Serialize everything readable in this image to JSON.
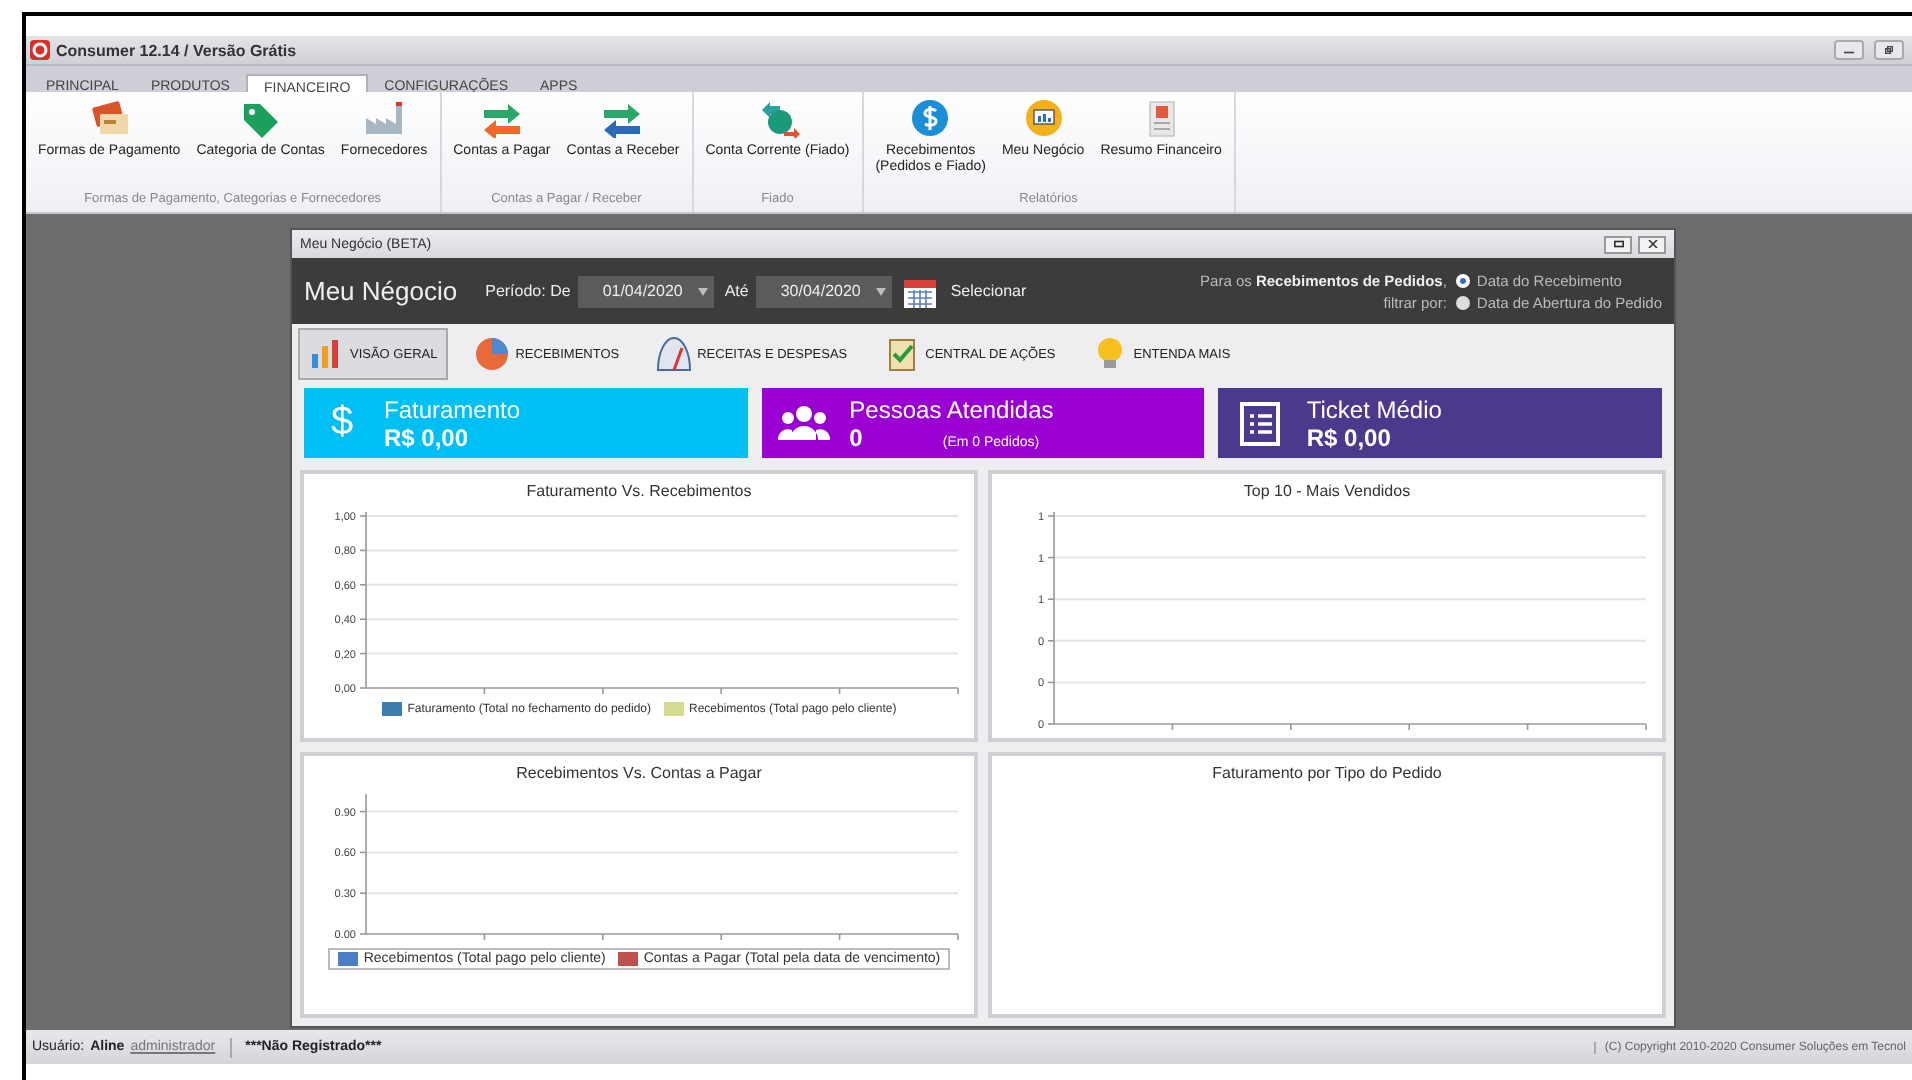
{
  "window": {
    "title": "Consumer 12.14 / Versão Grátis"
  },
  "menu_tabs": [
    {
      "label": "PRINCIPAL",
      "selected": false
    },
    {
      "label": "PRODUTOS",
      "selected": false
    },
    {
      "label": "FINANCEIRO",
      "selected": true
    },
    {
      "label": "CONFIGURAÇÕES",
      "selected": false
    },
    {
      "label": "APPS",
      "selected": false
    }
  ],
  "ribbon": {
    "groups": [
      {
        "label": "Formas de Pagamento, Categorias e Fornecedores",
        "items": [
          "Formas de Pagamento",
          "Categoria de Contas",
          "Fornecedores"
        ]
      },
      {
        "label": "Contas a Pagar / Receber",
        "items": [
          "Contas a Pagar",
          "Contas a Receber"
        ]
      },
      {
        "label": "Fiado",
        "items": [
          "Conta Corrente (Fiado)"
        ]
      },
      {
        "label": "Relatórios",
        "items": [
          "Recebimentos\n(Pedidos e Fiado)",
          "Meu Negócio",
          "Resumo Financeiro"
        ]
      }
    ]
  },
  "child_window": {
    "title": "Meu Negócio (BETA)",
    "header": {
      "heading": "Meu Négocio",
      "period_label": "Período: De",
      "date_from": "01/04/2020",
      "until_label": "Até",
      "date_to": "30/04/2020",
      "select_button": "Selecionar",
      "filter_label": "Para os **Recebimentos de Pedidos**,",
      "filter_label_2": "filtrar por:",
      "filter_options": [
        {
          "label": "Data do Recebimento",
          "selected": true
        },
        {
          "label": "Data de Abertura do Pedido",
          "selected": false
        }
      ]
    },
    "nav_tabs": [
      {
        "label": "VISÃO GERAL",
        "selected": true
      },
      {
        "label": "RECEBIMENTOS",
        "selected": false
      },
      {
        "label": "RECEITAS E DESPESAS",
        "selected": false
      },
      {
        "label": "CENTRAL DE AÇÕES",
        "selected": false
      },
      {
        "label": "ENTENDA MAIS",
        "selected": false
      }
    ],
    "kpis": [
      {
        "title": "Faturamento",
        "value": "R$ 0,00",
        "symbol": "$",
        "color": "#00bff3"
      },
      {
        "title": "Pessoas Atendidas",
        "value": "0",
        "note": "(Em 0 Pedidos)",
        "color": "#9a00d2"
      },
      {
        "title": "Ticket Médio",
        "value": "R$ 0,00",
        "color": "#4b3a8c"
      }
    ],
    "charts": [
      {
        "legend_framed": false,
        "chart_data": {
          "type": "bar",
          "title": "Faturamento Vs. Recebimentos",
          "grid": true,
          "ylim": [
            0,
            1
          ],
          "yticks": [
            {
              "value": 0,
              "label": "0,00"
            },
            {
              "value": 0.2,
              "label": "0,20"
            },
            {
              "value": 0.4,
              "label": "0,40"
            },
            {
              "value": 0.6,
              "label": "0,60"
            },
            {
              "value": 0.8,
              "label": "0,80"
            },
            {
              "value": 1,
              "label": "1,00"
            }
          ],
          "series": [
            {
              "name": "Faturamento (Total no fechamento do pedido)",
              "color": "#3a7fb0"
            },
            {
              "name": "Recebimentos (Total pago pelo cliente)",
              "color": "#d5dc8e"
            }
          ]
        }
      },
      {
        "title": "Top 10 - Mais Vendidos",
        "axis_labels": [
          "1",
          "1",
          "1",
          "0",
          "0",
          "0"
        ]
      },
      {
        "legend_framed": true,
        "chart_data": {
          "type": "bar",
          "title": "Recebimentos Vs. Contas a Pagar",
          "grid": true,
          "ylim": [
            0,
            1
          ],
          "yticks": [
            {
              "value": 0,
              "label": "0.00"
            },
            {
              "value": 0.3,
              "label": "0.30"
            },
            {
              "value": 0.6,
              "label": "0.60"
            },
            {
              "value": 0.9,
              "label": "0.90"
            }
          ],
          "series": [
            {
              "name": "Recebimentos (Total pago pelo cliente)",
              "color": "#4a7fc4"
            },
            {
              "name": "Contas a Pagar (Total pela data de vencimento)",
              "color": "#c0504d"
            }
          ]
        }
      },
      {
        "title": "Faturamento por Tipo do Pedido"
      }
    ]
  },
  "status_bar": {
    "user_label": "Usuário:",
    "user_name": "Aline",
    "user_role": "administrador",
    "registration": "***Não Registrado***",
    "copyright": "(C) Copyright 2010-2020 Consumer Soluções em Tecnol"
  }
}
